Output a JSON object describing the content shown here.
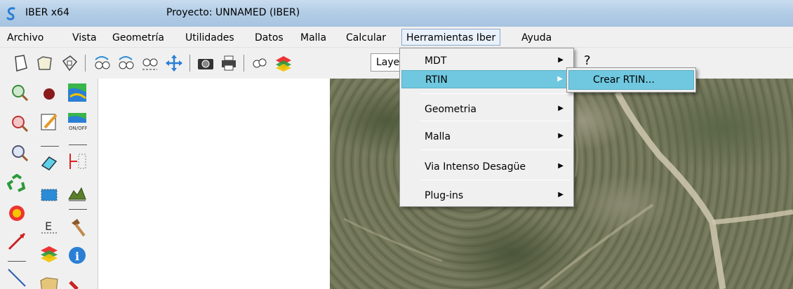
{
  "window": {
    "app_name": "IBER x64",
    "project_title": "Proyecto: UNNAMED (IBER)"
  },
  "menubar": {
    "items": [
      "Archivo",
      "Vista",
      "Geometría",
      "Utilidades",
      "Datos",
      "Malla",
      "Calcular",
      "Herramientas Iber",
      "Ayuda"
    ],
    "active_index": 7
  },
  "toolbar": {
    "layer_select_value": "Layer",
    "help_glyph": "?"
  },
  "dropdown": {
    "items": [
      "MDT",
      "RTIN",
      "Geometria",
      "Malla",
      "Via Intenso Desagüe",
      "Plug-ins"
    ],
    "highlighted_index": 1
  },
  "submenu": {
    "items": [
      "Crear RTIN..."
    ],
    "highlighted_index": 0
  },
  "colors": {
    "highlight": "#6fc8df",
    "titlebar": "#b3cde6",
    "chrome": "#f0f0f0"
  }
}
